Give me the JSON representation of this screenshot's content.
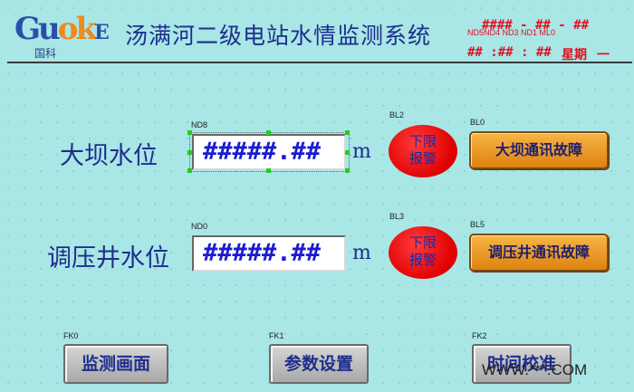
{
  "header": {
    "logo_letters_1": "Gu",
    "logo_letters_2": "ok",
    "logo_letters_3": "E",
    "logo_sub": "国科",
    "title": "汤满河二级电站水情监测系统",
    "tags_top": "ND5ND4 ND3  ND1 ML0",
    "date_text": "#### - ## - ##",
    "time_text": "## :## : ##",
    "weekday_label": "星期",
    "weekday_value": "一"
  },
  "dam": {
    "label": "大坝水位",
    "tag": "ND8",
    "value": "#####.##",
    "unit": "m",
    "alarm_tag": "BL2",
    "alarm_line1": "下限",
    "alarm_line2": "报警",
    "fault_tag": "BL0",
    "fault_label": "大坝通讯故障"
  },
  "pressure": {
    "label": "调压井水位",
    "tag": "ND0",
    "value": "#####.##",
    "unit": "m",
    "alarm_tag": "BL3",
    "alarm_line1": "下限",
    "alarm_line2": "报警",
    "fault_tag": "BL5",
    "fault_label": "调压井通讯故障"
  },
  "nav": [
    {
      "tag": "FK0",
      "label": "监测画面"
    },
    {
      "tag": "FK1",
      "label": "参数设置"
    },
    {
      "tag": "FK2",
      "label": "时间校准"
    }
  ],
  "footer": {
    "watermark": "WWW.***.COM"
  },
  "colors": {
    "background": "#a9e6e6",
    "title_text": "#1e2e8c",
    "alarm_red": "#e00000",
    "fault_orange": "#de8210",
    "value_blue": "#1b1bd0"
  }
}
